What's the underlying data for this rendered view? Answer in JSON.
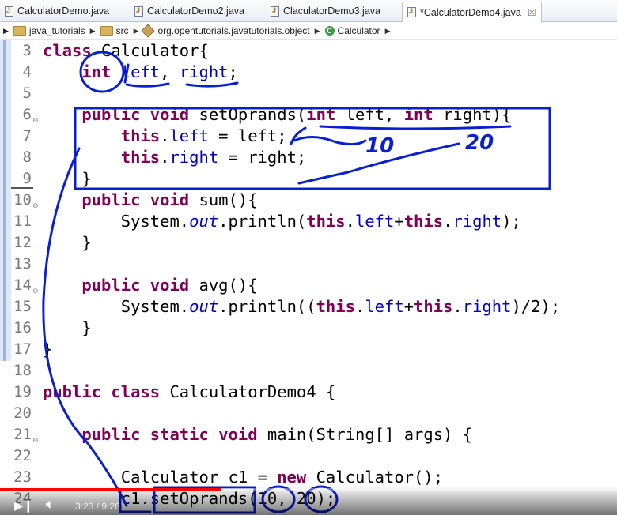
{
  "tabs": [
    {
      "label": "CalculatorDemo.java"
    },
    {
      "label": "CalculatorDemo2.java"
    },
    {
      "label": "ClaculatorDemo3.java"
    },
    {
      "label": "*CalculatorDemo4.java",
      "close": "☒"
    }
  ],
  "breadcrumb": [
    {
      "label": "java_tutorials",
      "icon": "project-icon"
    },
    {
      "label": "src",
      "icon": "source-folder-icon"
    },
    {
      "label": "org.opentutorials.javatutorials.object",
      "icon": "package-icon"
    },
    {
      "label": "Calculator",
      "icon": "class-icon"
    }
  ],
  "code_lines": [
    {
      "n": "3",
      "text": "class Calculator{"
    },
    {
      "n": "4",
      "text": "    int left, right;"
    },
    {
      "n": "5",
      "text": ""
    },
    {
      "n": "6",
      "text": "    public void setOprands(int left, int right){"
    },
    {
      "n": "7",
      "text": "        this.left = left;"
    },
    {
      "n": "8",
      "text": "        this.right = right;"
    },
    {
      "n": "9",
      "text": "    }"
    },
    {
      "n": "10",
      "text": "    public void sum(){"
    },
    {
      "n": "11",
      "text": "        System.out.println(this.left+this.right);"
    },
    {
      "n": "12",
      "text": "    }"
    },
    {
      "n": "13",
      "text": ""
    },
    {
      "n": "14",
      "text": "    public void avg(){"
    },
    {
      "n": "15",
      "text": "        System.out.println((this.left+this.right)/2);"
    },
    {
      "n": "16",
      "text": "    }"
    },
    {
      "n": "17",
      "text": "}"
    },
    {
      "n": "18",
      "text": ""
    },
    {
      "n": "19",
      "text": "public class CalculatorDemo4 {"
    },
    {
      "n": "20",
      "text": ""
    },
    {
      "n": "21",
      "text": "    public static void main(String[] args) {"
    },
    {
      "n": "22",
      "text": ""
    },
    {
      "n": "23",
      "text": "        Calculator c1 = new Calculator();"
    },
    {
      "n": "24",
      "text": "        c1.setOprands(10, 20);"
    }
  ],
  "annotations": {
    "arg1": "10",
    "arg2": "20"
  },
  "video": {
    "current_time": "3:23",
    "duration": "9:26",
    "time_label": "3:23 / 9:26",
    "progress": 0.358
  },
  "colors": {
    "keyword": "#7f0055",
    "field": "#0000c0",
    "ink": "#0a1fd0",
    "progress": "#ff0000"
  }
}
